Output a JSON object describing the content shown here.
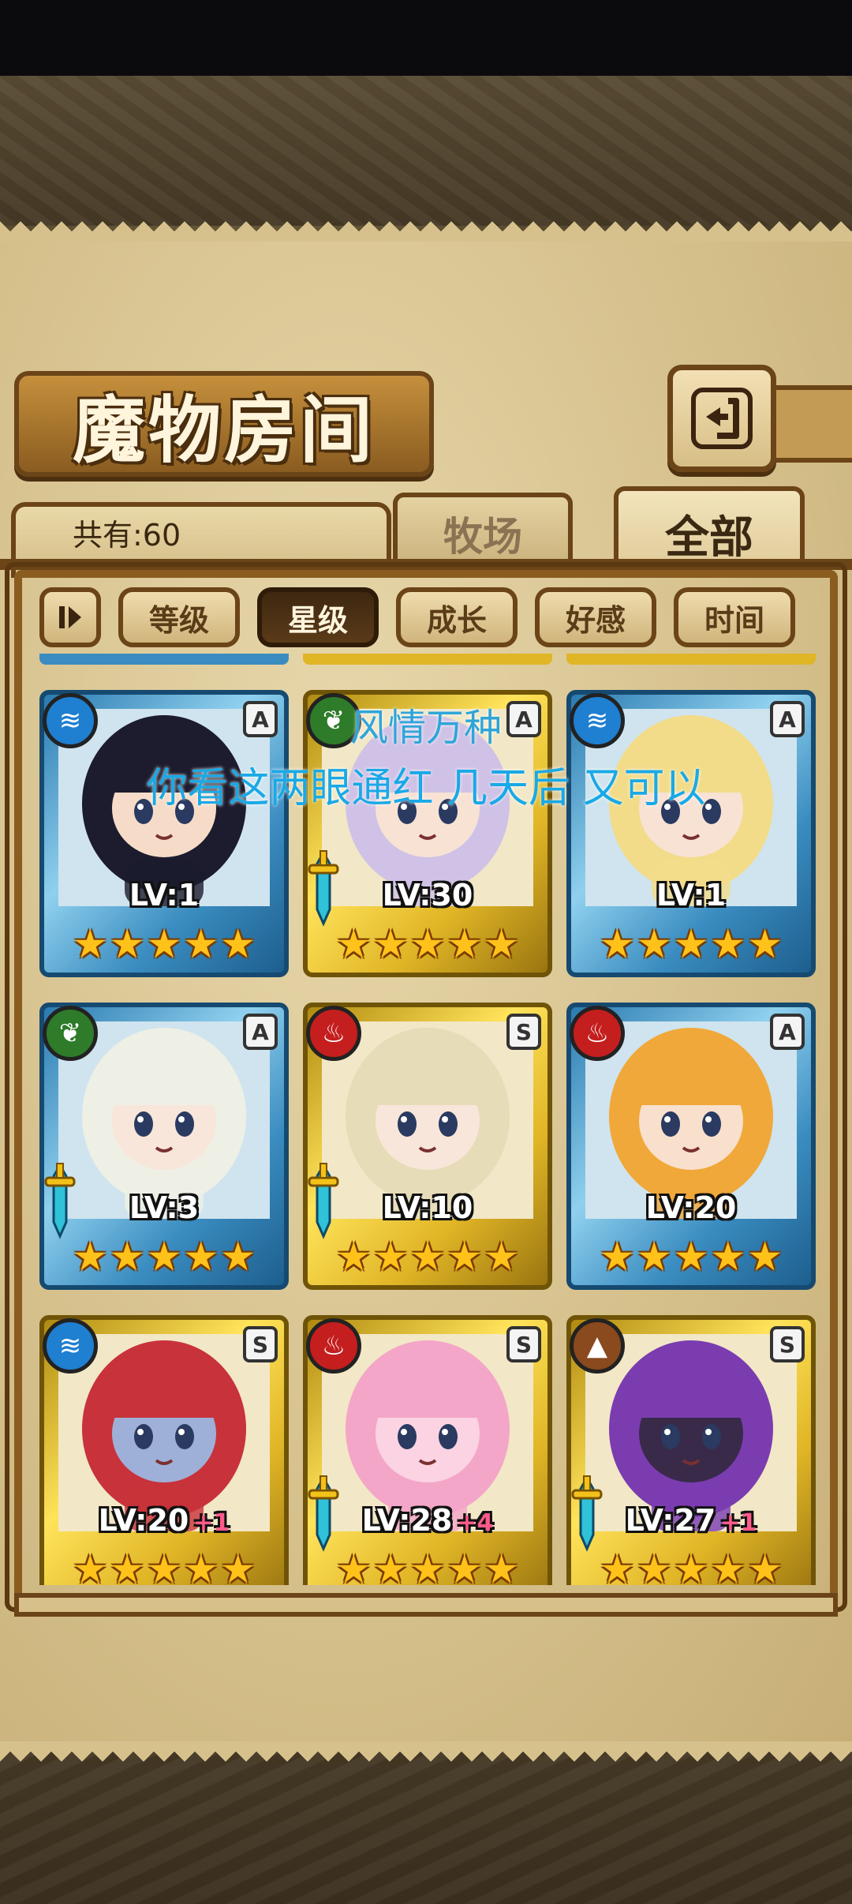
{
  "screen": {
    "title": "魔物房间",
    "count_label": "共有:60"
  },
  "tabs": [
    {
      "label": "牧场",
      "selected": false
    },
    {
      "label": "全部",
      "selected": true
    }
  ],
  "sort_options": [
    {
      "label": "等级",
      "selected": false
    },
    {
      "label": "星级",
      "selected": true
    },
    {
      "label": "成长",
      "selected": false
    },
    {
      "label": "好感",
      "selected": false
    },
    {
      "label": "时间",
      "selected": false
    }
  ],
  "cards": [
    {
      "level_label": "LV:1",
      "bonus": "",
      "rank": "A",
      "element": "water",
      "frame": "blue",
      "stars": 5,
      "weapon": false,
      "hair": "#1c1c2e",
      "skin": "#f6dcc8"
    },
    {
      "level_label": "LV:30",
      "bonus": "",
      "rank": "A",
      "element": "wood",
      "frame": "gold",
      "stars": 5,
      "weapon": true,
      "hair": "#cfc2e6",
      "skin": "#f8e2d4"
    },
    {
      "level_label": "LV:1",
      "bonus": "",
      "rank": "A",
      "element": "water",
      "frame": "blue",
      "stars": 5,
      "weapon": false,
      "hair": "#f2dc8a",
      "skin": "#f8e2d4"
    },
    {
      "level_label": "LV:3",
      "bonus": "",
      "rank": "A",
      "element": "wood",
      "frame": "blue",
      "stars": 5,
      "weapon": true,
      "hair": "#eef0e6",
      "skin": "#f8e6da"
    },
    {
      "level_label": "LV:10",
      "bonus": "",
      "rank": "S",
      "element": "fire",
      "frame": "gold",
      "stars": 5,
      "weapon": true,
      "hair": "#e6dcb8",
      "skin": "#f8e6da"
    },
    {
      "level_label": "LV:20",
      "bonus": "",
      "rank": "A",
      "element": "fire",
      "frame": "blue",
      "stars": 5,
      "weapon": false,
      "hair": "#f0a83a",
      "skin": "#f8e0cc"
    },
    {
      "level_label": "LV:20",
      "bonus": "+1",
      "rank": "S",
      "element": "water",
      "frame": "gold",
      "stars": 5,
      "weapon": false,
      "hair": "#c8323a",
      "skin": "#9fb0d8"
    },
    {
      "level_label": "LV:28",
      "bonus": "+4",
      "rank": "S",
      "element": "fire",
      "frame": "gold",
      "stars": 5,
      "weapon": true,
      "hair": "#f4a6c8",
      "skin": "#fbd3e2"
    },
    {
      "level_label": "LV:27",
      "bonus": "+1",
      "rank": "S",
      "element": "earth",
      "frame": "gold",
      "stars": 5,
      "weapon": true,
      "hair": "#7b3cb0",
      "skin": "#3a2a4a"
    }
  ],
  "overlay": {
    "line1": "风情万种",
    "line2": "你看这两眼通红 几天后 又可以"
  },
  "icons": {
    "back": "back-arrow-icon",
    "toggle": "pause-toggle-icon",
    "water": "water-element-icon",
    "wood": "leaf-element-icon",
    "fire": "fire-element-icon",
    "earth": "mountain-element-icon",
    "star": "star-icon",
    "sword": "sword-icon"
  },
  "colors": {
    "panel": "#d6c18d",
    "wood_border": "#6b4418",
    "star": "#ffc21a",
    "blue_frame": "#3a8cc0",
    "gold_frame": "#e0b526",
    "overlay_text": "#19a9e6"
  }
}
